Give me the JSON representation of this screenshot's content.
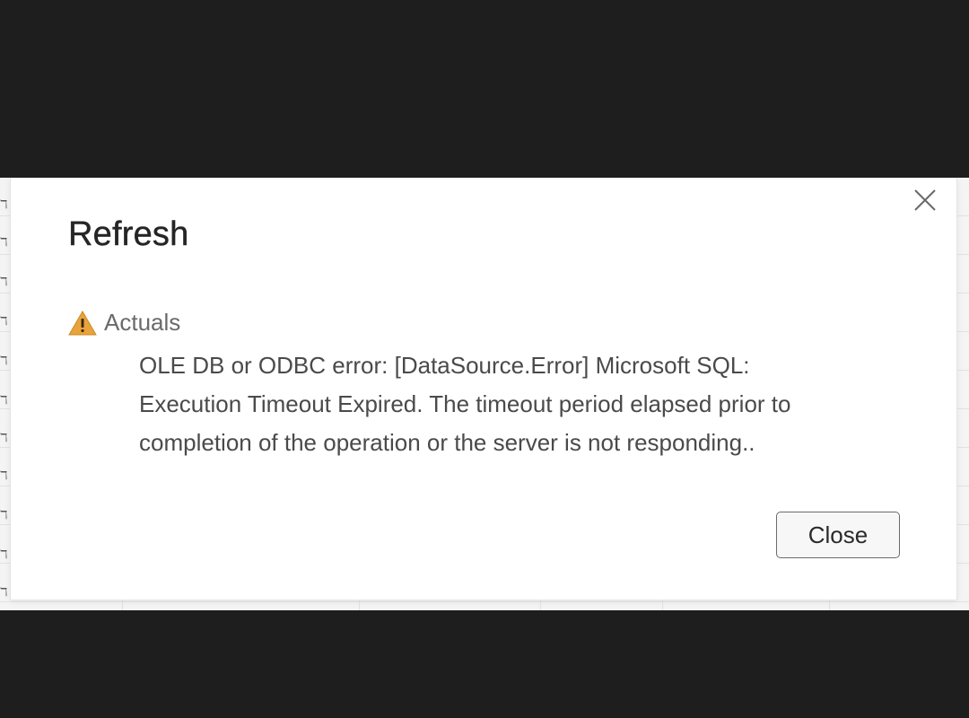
{
  "dialog": {
    "title": "Refresh",
    "close_icon": "close-icon",
    "error": {
      "icon": "warning-icon",
      "icon_color": "#e8a33b",
      "source": "Actuals",
      "message": "OLE DB or ODBC error: [DataSource.Error] Microsoft SQL: Execution Timeout Expired. The timeout period elapsed prior to completion of the operation or the server is not responding.."
    },
    "close_button_label": "Close"
  }
}
